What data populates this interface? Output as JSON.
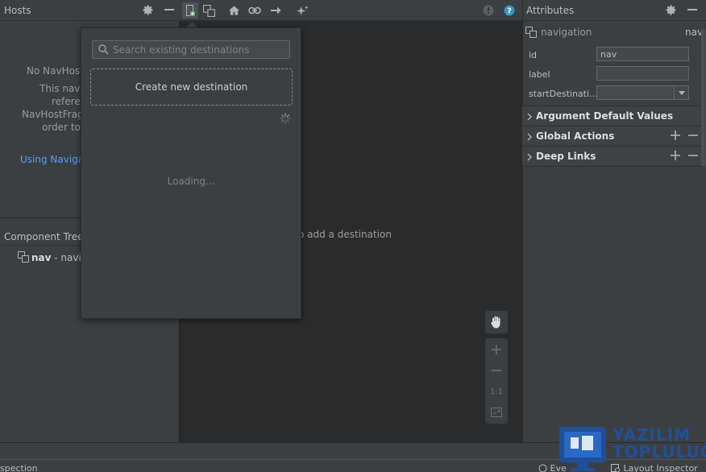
{
  "hosts": {
    "title": "Hosts",
    "message_lines": [
      "No NavHost",
      "This nav g",
      "referer",
      "NavHostFragm",
      "order to l"
    ],
    "link": "Using Navigat"
  },
  "tree": {
    "title": "Component Tree",
    "row_name": "nav",
    "row_suffix": " - navig"
  },
  "canvas": {
    "hint": "o add a destination",
    "zoom": {
      "fit_label": "1:1"
    }
  },
  "popup": {
    "search_placeholder": "Search existing destinations",
    "create_label": "Create new destination",
    "loading": "Loading..."
  },
  "attributes": {
    "title": "Attributes",
    "nav_type": "navigation",
    "nav_name": "nav",
    "fields": [
      {
        "label": "id",
        "value": "nav"
      },
      {
        "label": "label",
        "value": ""
      },
      {
        "label": "startDestinati...",
        "value": ""
      }
    ],
    "sections": [
      "Argument Default Values",
      "Global Actions",
      "Deep Links"
    ]
  },
  "status": {
    "left": "spection",
    "events": "Eve",
    "layout_inspector": "Layout Inspector"
  },
  "watermark": {
    "line1": "YAZILIM",
    "line2": "TOPLULUĞU"
  },
  "colors": {
    "accent": "#589df6",
    "panel": "#3c3f41",
    "canvas": "#2b2b2b",
    "watermark": "#1f4f9a"
  }
}
